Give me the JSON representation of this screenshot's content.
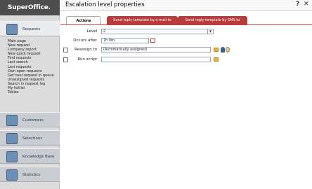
{
  "app": {
    "logo": "SuperOffice."
  },
  "sidebar": {
    "sections": [
      {
        "label": "Requests",
        "icon": "requests-icon"
      },
      {
        "label": "Customers",
        "icon": "customers-icon"
      },
      {
        "label": "Selections",
        "icon": "selections-icon"
      },
      {
        "label": "Knowledge Base",
        "icon": "knowledge-base-icon"
      },
      {
        "label": "Statistics",
        "icon": "statistics-icon"
      }
    ],
    "nav_items": [
      "Main page",
      "New request",
      "Company report",
      "New quick request",
      "Find requests",
      "Last search",
      "Last requests",
      "Own open requests",
      "Get next request in queue",
      "Unassigned requests",
      "Search in request log",
      "My hotlist",
      "Tables"
    ]
  },
  "dialog": {
    "title": "Escalation level properties",
    "help": "?",
    "close": "✕"
  },
  "tabs": {
    "actions": "Actions",
    "email": "Send reply template by e-mail to",
    "sms": "Send reply template by SMS to"
  },
  "form": {
    "level_label": "Level",
    "level_value": "2",
    "occurs_label": "Occurs after",
    "occurs_value": "7h 0m",
    "reassign_label": "Reassign to",
    "reassign_value": "(Automatically assigned)",
    "script_label": "Run script",
    "script_value": ""
  },
  "colors": {
    "tab_accent": "#b83c3c",
    "sidebar": "#dcdcdc",
    "logo_bg": "#4d4d4d"
  }
}
